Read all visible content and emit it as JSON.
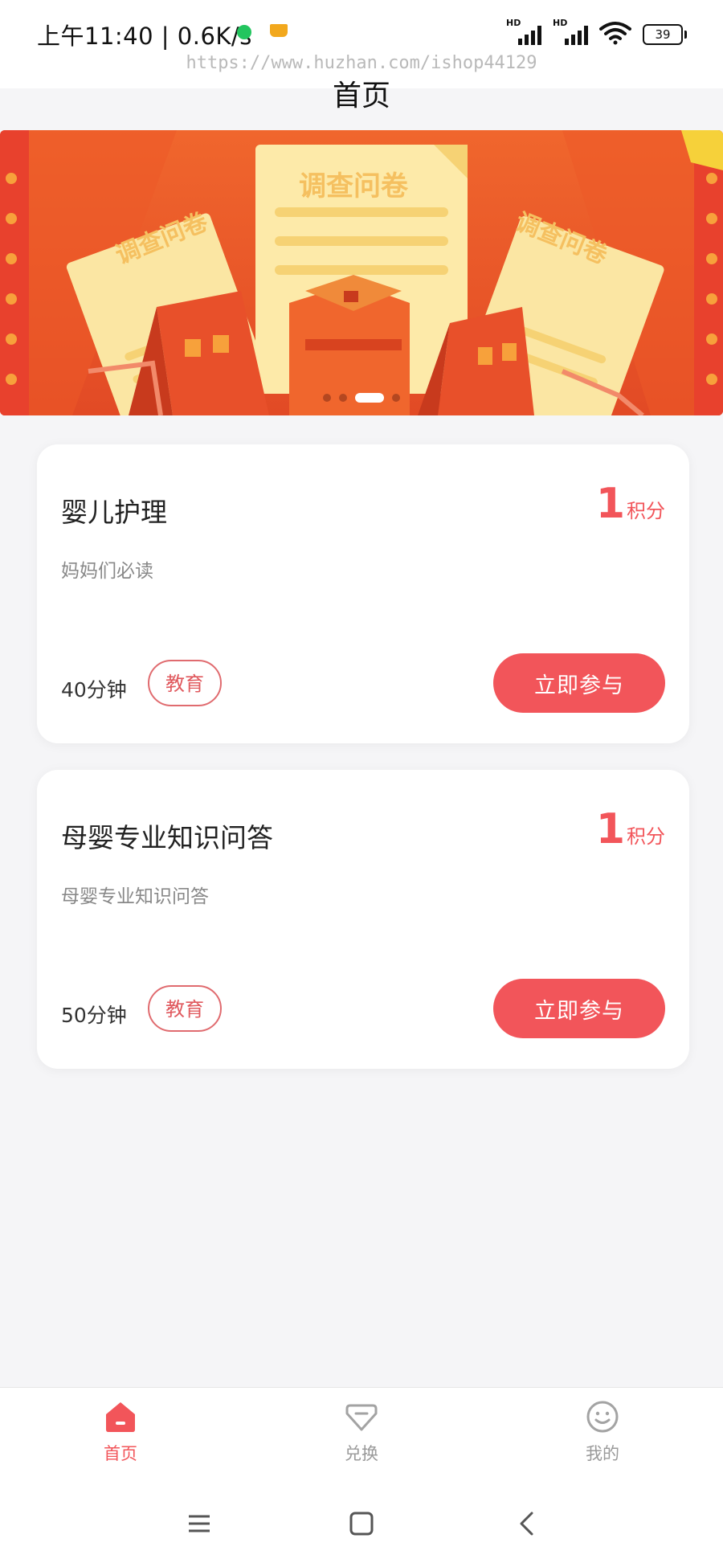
{
  "status_bar": {
    "time": "上午11:40 | 0.6K/s",
    "network_icons": [
      "hd-signal-icon",
      "hd-signal-icon",
      "wifi-icon"
    ],
    "battery": "39",
    "dot_color": "#22c55e"
  },
  "watermark": "https://www.huzhan.com/ishop44129",
  "header": {
    "title": "首页"
  },
  "banner": {
    "papers": [
      "调查问卷",
      "调查问卷",
      "调查问卷"
    ],
    "active_slide": 3,
    "slide_count": 4
  },
  "surveys": [
    {
      "title": "婴儿护理",
      "points": "1",
      "points_unit": "积分",
      "description": "妈妈们必读",
      "duration": "40分钟",
      "tag": "教育",
      "action_label": "立即参与"
    },
    {
      "title": "母婴专业知识问答",
      "points": "1",
      "points_unit": "积分",
      "description": "母婴专业知识问答",
      "duration": "50分钟",
      "tag": "教育",
      "action_label": "立即参与"
    }
  ],
  "tabbar": {
    "tabs": [
      {
        "label": "首页",
        "icon": "home-icon",
        "active": true
      },
      {
        "label": "兑换",
        "icon": "diamond-icon",
        "active": false
      },
      {
        "label": "我的",
        "icon": "smiley-icon",
        "active": false
      }
    ]
  },
  "system_nav": [
    "menu-icon",
    "home-square-icon",
    "back-icon"
  ],
  "colors": {
    "accent": "#f2555a",
    "banner_bg": "#e8502a"
  }
}
